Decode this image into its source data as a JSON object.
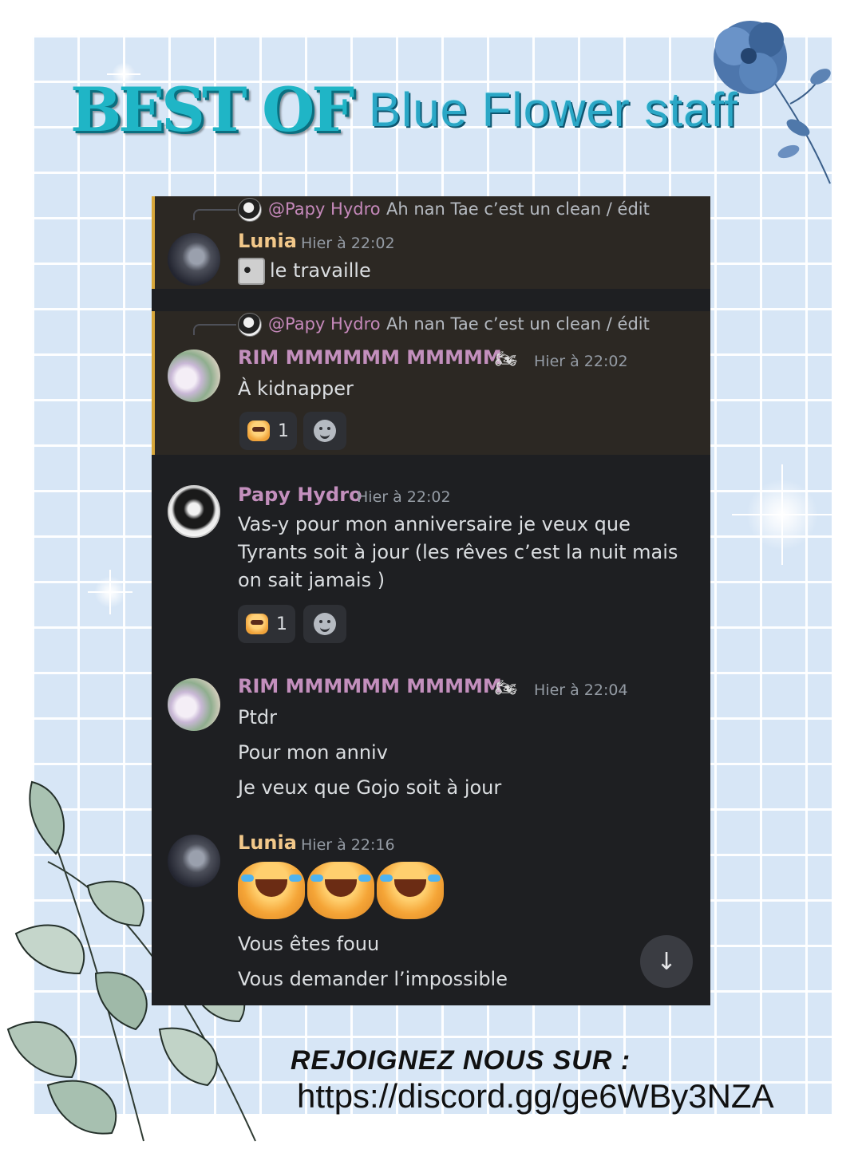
{
  "header": {
    "best_of": "BEST OF",
    "title": "Blue Flower staff"
  },
  "messages": [
    {
      "reply_to": {
        "name": "@Papy Hydro",
        "text": "Ah nan Tae c’est un clean / édit"
      },
      "author": "Lunia",
      "time": "Hier à 22:02",
      "lines": [
        "le travaille"
      ]
    },
    {
      "reply_to": {
        "name": "@Papy Hydro",
        "text": "Ah nan Tae c’est un clean / édit"
      },
      "author": "RIM MMMMMM MMMMM",
      "author_badge": "motorcycle",
      "time": "Hier à 22:02",
      "lines": [
        "À kidnapper"
      ],
      "reaction_count": "1"
    },
    {
      "author": "Papy Hydro",
      "time": "Hier à 22:02",
      "text": "Vas-y pour mon anniversaire je veux que Tyrants soit à jour (les rêves c’est la nuit mais on sait jamais )",
      "reaction_count": "1"
    },
    {
      "author": "RIM MMMMMM MMMMM",
      "author_badge": "motorcycle",
      "time": "Hier à 22:04",
      "lines": [
        "Ptdr",
        "Pour mon anniv",
        "Je veux que Gojo soit à jour"
      ]
    },
    {
      "author": "Lunia",
      "time": "Hier à 22:16",
      "emoji_count": 3,
      "lines": [
        "Vous êtes fouu",
        "Vous demander l’impossible"
      ]
    }
  ],
  "footer": {
    "join": "REJOIGNEZ NOUS SUR :",
    "link": "https://discord.gg/ge6WBy3NZA"
  },
  "colors": {
    "background_grid": "#d7e6f6",
    "chat_bg": "#1e1f22",
    "highlight_bg": "#2c2823",
    "highlight_bar": "#d8a73a",
    "lunia_name": "#f2c88a",
    "rim_name": "#c38fbd"
  }
}
